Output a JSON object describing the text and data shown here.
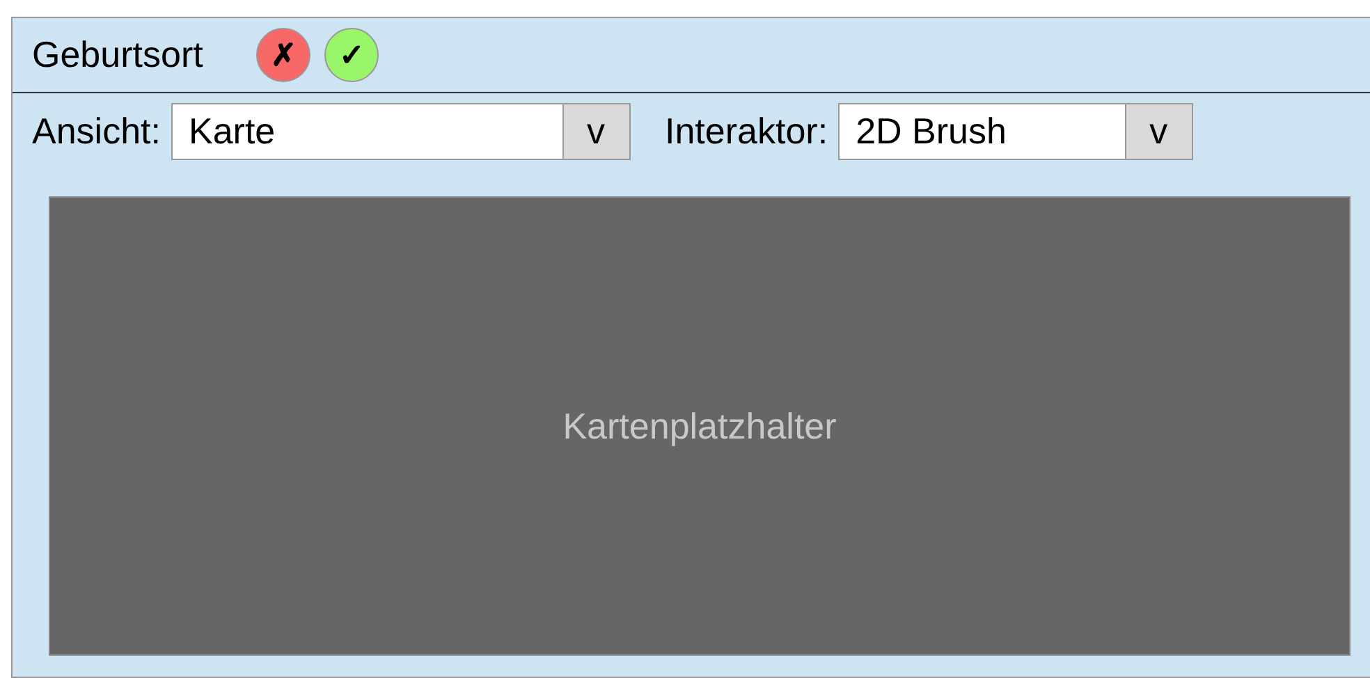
{
  "header": {
    "title": "Geburtsort",
    "buttons": [
      {
        "kind": "cancel",
        "label": "✗"
      },
      {
        "kind": "confirm",
        "label": "✓"
      }
    ]
  },
  "controls": [
    {
      "label": "Ansicht:",
      "value": "Karte",
      "toggle": "v"
    },
    {
      "label": "Interaktor:",
      "value": "2D Brush",
      "toggle": "v"
    }
  ],
  "map": {
    "placeholder": "Kartenplatzhalter"
  }
}
